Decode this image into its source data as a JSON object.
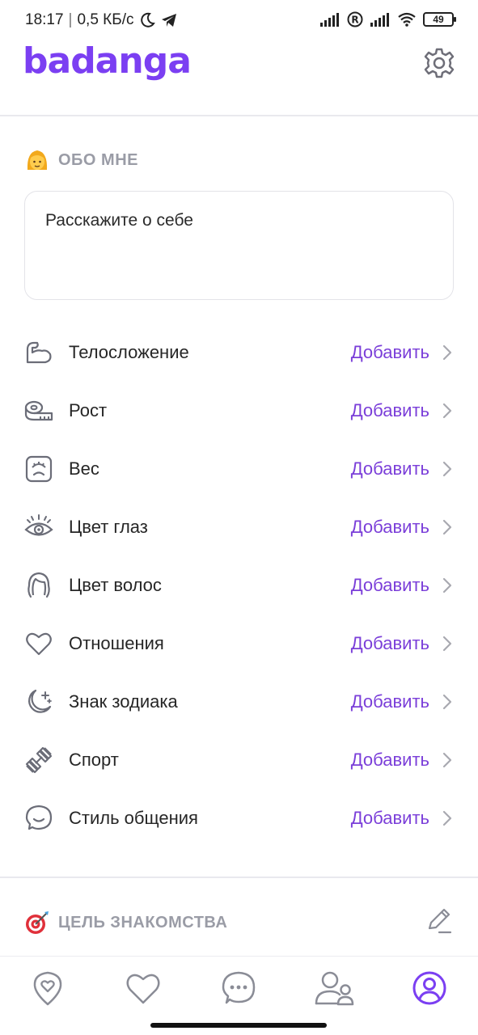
{
  "status_bar": {
    "time": "18:17",
    "network_speed": "0,5 КБ/с",
    "battery": "49"
  },
  "header": {
    "logo": "badanga"
  },
  "about": {
    "title": "ОБО МНЕ",
    "placeholder": "Расскажите о себе"
  },
  "details": [
    {
      "label": "Телосложение",
      "action": "Добавить",
      "icon": "arm-muscle-icon"
    },
    {
      "label": "Рост",
      "action": "Добавить",
      "icon": "tape-measure-icon"
    },
    {
      "label": "Вес",
      "action": "Добавить",
      "icon": "scale-icon"
    },
    {
      "label": "Цвет глаз",
      "action": "Добавить",
      "icon": "eye-icon"
    },
    {
      "label": "Цвет волос",
      "action": "Добавить",
      "icon": "hair-icon"
    },
    {
      "label": "Отношения",
      "action": "Добавить",
      "icon": "heart-icon"
    },
    {
      "label": "Знак зодиака",
      "action": "Добавить",
      "icon": "moon-stars-icon"
    },
    {
      "label": "Спорт",
      "action": "Добавить",
      "icon": "dumbbell-icon"
    },
    {
      "label": "Стиль общения",
      "action": "Добавить",
      "icon": "chat-smile-icon"
    }
  ],
  "goal": {
    "title": "ЦЕЛЬ ЗНАКОМСТВА"
  },
  "nav": [
    "location-heart-icon",
    "heart-icon",
    "chat-icon",
    "users-icon",
    "profile-icon"
  ],
  "colors": {
    "accent": "#7b3ff2",
    "action_text": "#7b3fd9",
    "section_title": "#9a9ca6"
  }
}
